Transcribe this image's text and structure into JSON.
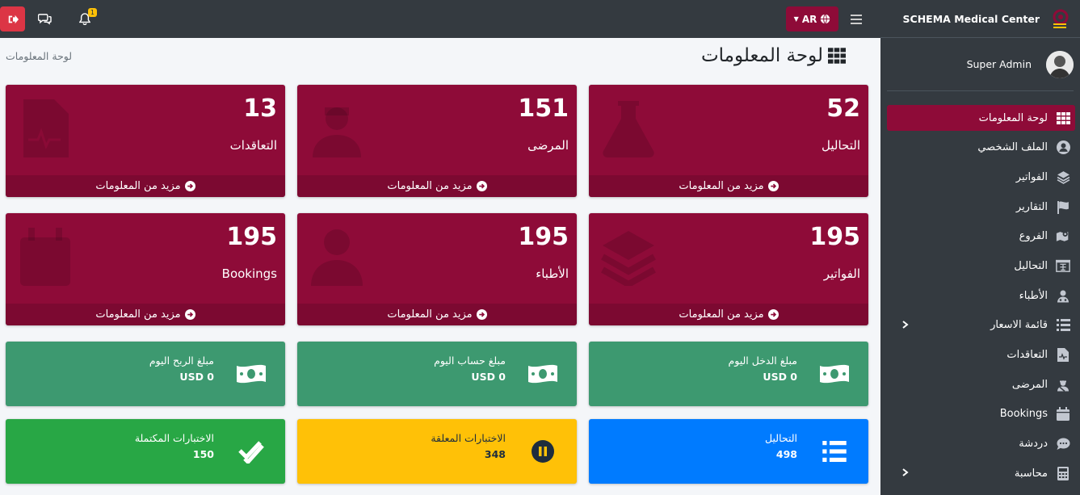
{
  "navbar": {
    "lang_label": "AR",
    "notification_count": "1"
  },
  "sidebar": {
    "brand": "SCHEMA Medical Center",
    "user_name": "Super Admin",
    "items": [
      {
        "label": "لوحة المعلومات",
        "icon": "grid-icon",
        "active": true
      },
      {
        "label": "الملف الشخصي",
        "icon": "user-circle-icon"
      },
      {
        "label": "الفواتير",
        "icon": "layers-icon"
      },
      {
        "label": "التقارير",
        "icon": "flag-icon"
      },
      {
        "label": "الفروع",
        "icon": "map-icon"
      },
      {
        "label": "التحاليل",
        "icon": "lab-icon"
      },
      {
        "label": "الأطباء",
        "icon": "doctor-icon"
      },
      {
        "label": "قائمة الاسعار",
        "icon": "list-icon",
        "has_children": true
      },
      {
        "label": "التعاقدات",
        "icon": "file-medical-icon"
      },
      {
        "label": "المرضى",
        "icon": "patient-icon"
      },
      {
        "label": "Bookings",
        "icon": "calendar-icon"
      },
      {
        "label": "دردشة",
        "icon": "chat-icon"
      },
      {
        "label": "محاسبة",
        "icon": "calculator-icon",
        "has_children": true
      }
    ]
  },
  "header": {
    "title": "لوحة المعلومات",
    "breadcrumb": "لوحة المعلومات"
  },
  "stat_cards": [
    {
      "number": "52",
      "label": "التحاليل",
      "footer": "مزيد من المعلومات",
      "icon": "flask-icon"
    },
    {
      "number": "151",
      "label": "المرضى",
      "footer": "مزيد من المعلومات",
      "icon": "patient-icon"
    },
    {
      "number": "13",
      "label": "التعاقدات",
      "footer": "مزيد من المعلومات",
      "icon": "file-medical-icon"
    },
    {
      "number": "195",
      "label": "الفواتير",
      "footer": "مزيد من المعلومات",
      "icon": "layers-icon"
    },
    {
      "number": "195",
      "label": "الأطباء",
      "footer": "مزيد من المعلومات",
      "icon": "doctor-icon"
    },
    {
      "number": "195",
      "label": "Bookings",
      "footer": "مزيد من المعلومات",
      "icon": "calendar-icon"
    }
  ],
  "money_boxes": [
    {
      "label": "مبلغ الدخل اليوم",
      "value": "USD 0",
      "icon": "money-bill-icon"
    },
    {
      "label": "مبلغ حساب اليوم",
      "value": "USD 0",
      "icon": "money-bill-icon"
    },
    {
      "label": "مبلغ الربح اليوم",
      "value": "USD 0",
      "icon": "money-bill-icon"
    }
  ],
  "test_boxes": [
    {
      "label": "التحاليل",
      "value": "498",
      "icon": "list-icon"
    },
    {
      "label": "الاختبارات المعلقة",
      "value": "348",
      "icon": "pause-icon"
    },
    {
      "label": "الاختبارات المكتملة",
      "value": "150",
      "icon": "check-double-icon"
    }
  ],
  "colors": {
    "accent": "#8e0b38",
    "navbar": "#343a40",
    "green": "#3d9970",
    "success": "#28a745",
    "warning": "#ffc107",
    "primary": "#007bff"
  }
}
